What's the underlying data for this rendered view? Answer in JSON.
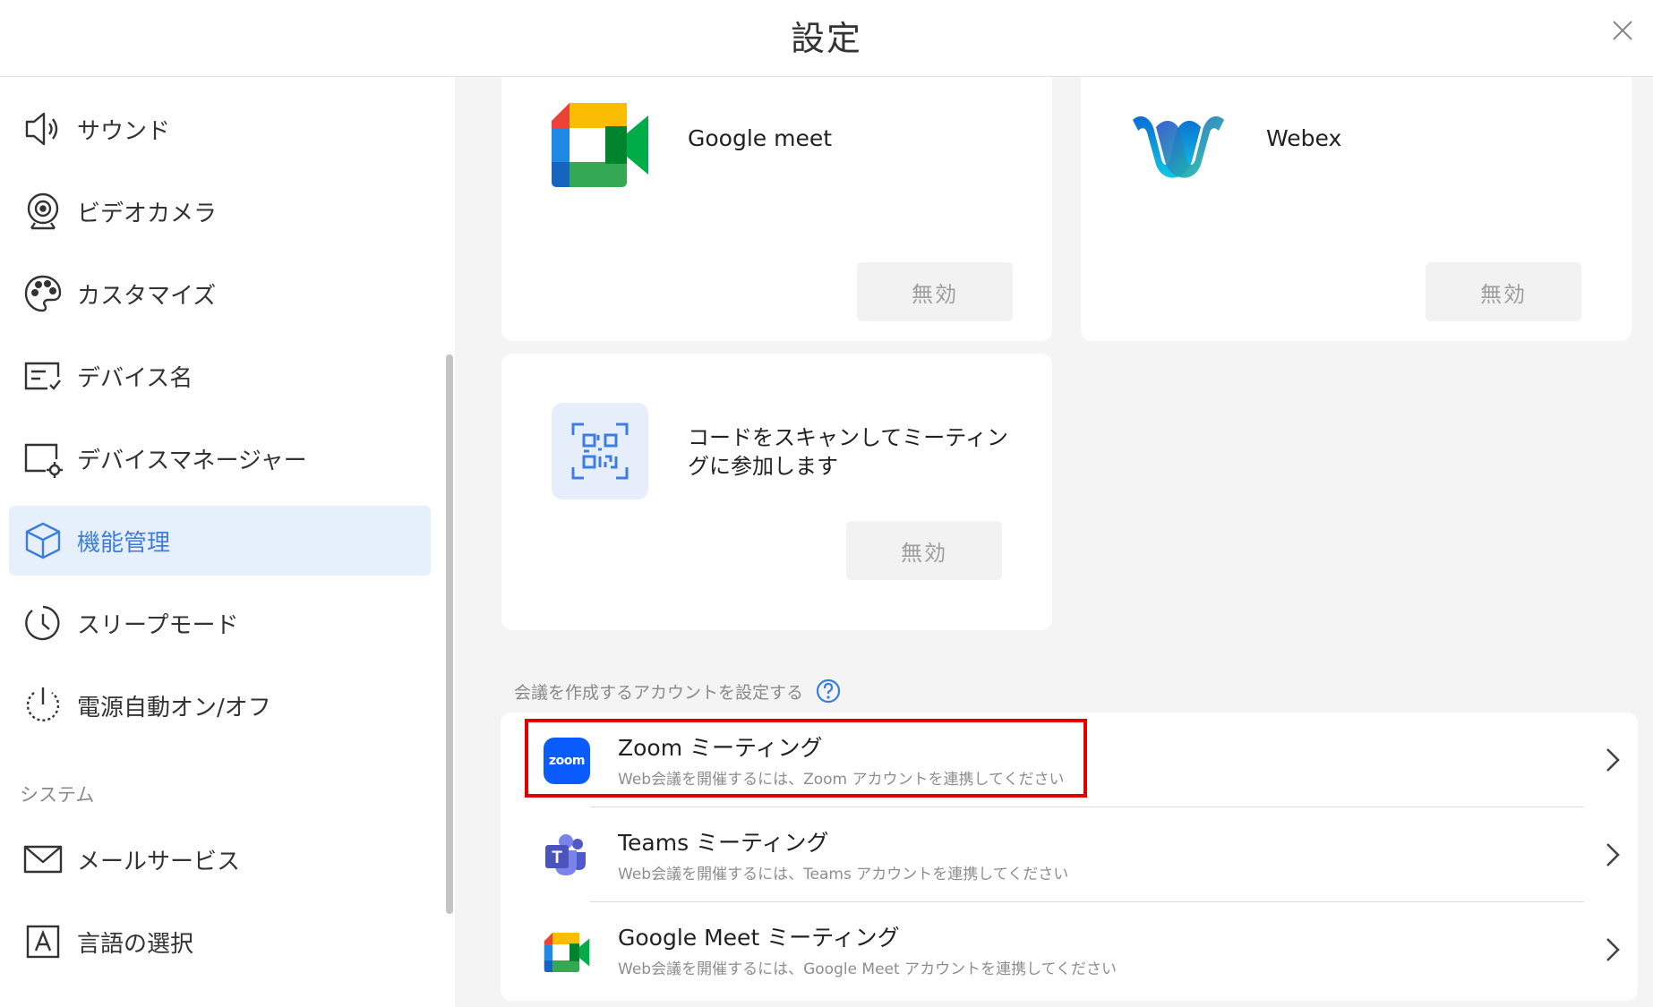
{
  "header": {
    "title": "設定"
  },
  "sidebar": {
    "items": [
      {
        "label": "サウンド",
        "icon": "speaker-icon"
      },
      {
        "label": "ビデオカメラ",
        "icon": "webcam-icon"
      },
      {
        "label": "カスタマイズ",
        "icon": "palette-icon"
      },
      {
        "label": "デバイス名",
        "icon": "device-name-icon"
      },
      {
        "label": "デバイスマネージャー",
        "icon": "device-manager-icon"
      },
      {
        "label": "機能管理",
        "icon": "cube-icon",
        "active": true
      },
      {
        "label": "スリープモード",
        "icon": "clock-icon"
      },
      {
        "label": "電源自動オン/オフ",
        "icon": "power-icon"
      }
    ],
    "section_system": "システム",
    "system_items": [
      {
        "label": "メールサービス",
        "icon": "mail-icon"
      },
      {
        "label": "言語の選択",
        "icon": "language-icon"
      }
    ]
  },
  "main": {
    "cards": [
      {
        "name": "Google meet",
        "button": "無効",
        "icon": "google-meet-icon"
      },
      {
        "name": "Webex",
        "button": "無効",
        "icon": "webex-icon"
      },
      {
        "name": "コードをスキャンしてミーティングに参加します",
        "button": "無効",
        "icon": "qr-code-icon"
      }
    ],
    "account_section_label": "会議を作成するアカウントを設定する",
    "accounts": [
      {
        "title": "Zoom ミーティング",
        "subtitle": "Web会議を開催するには、Zoom アカウントを連携してください",
        "logo_text": "zoom"
      },
      {
        "title": "Teams ミーティング",
        "subtitle": "Web会議を開催するには、Teams アカウントを連携してください",
        "logo_text": "T"
      },
      {
        "title": "Google Meet ミーティング",
        "subtitle": "Web会議を開催するには、Google Meet アカウントを連携してください"
      }
    ]
  },
  "colors": {
    "accent": "#3d7de0",
    "active_bg": "#e6f0fd",
    "highlight": "#e00000",
    "zoom": "#0b5cff",
    "teams": "#5059c9"
  }
}
